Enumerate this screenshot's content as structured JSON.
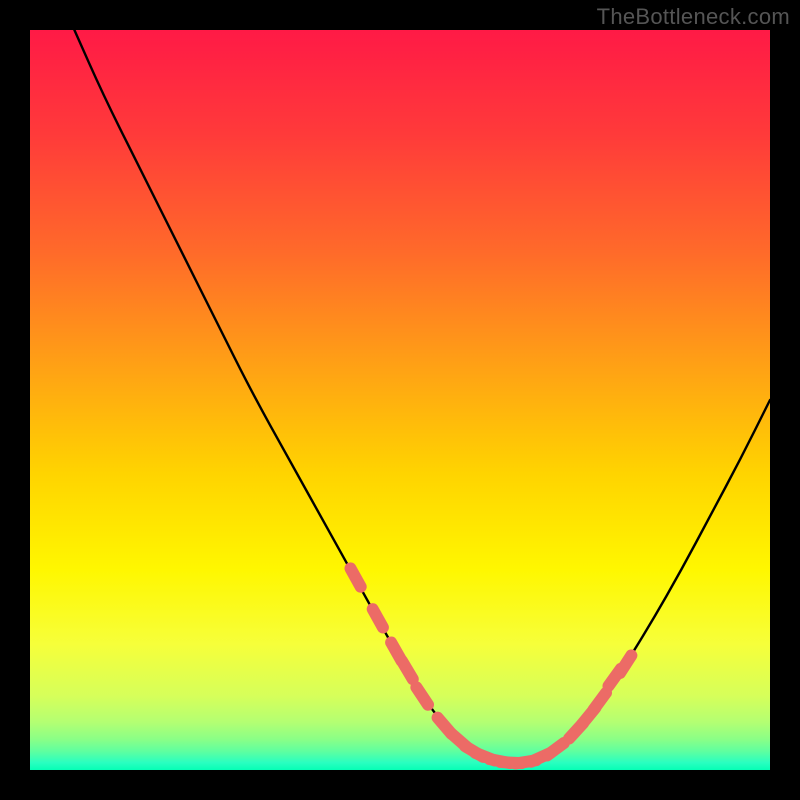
{
  "watermark": "TheBottleneck.com",
  "colors": {
    "frame": "#000000",
    "curve_stroke": "#000000",
    "marker_fill": "#ec6b66",
    "marker_stroke": "#ec6b66",
    "gradient_stops": [
      {
        "offset": 0.0,
        "color": "#ff1a46"
      },
      {
        "offset": 0.14,
        "color": "#ff3a3a"
      },
      {
        "offset": 0.3,
        "color": "#ff6a2a"
      },
      {
        "offset": 0.46,
        "color": "#ffa314"
      },
      {
        "offset": 0.6,
        "color": "#ffd400"
      },
      {
        "offset": 0.73,
        "color": "#fff700"
      },
      {
        "offset": 0.83,
        "color": "#f6ff3a"
      },
      {
        "offset": 0.9,
        "color": "#d6ff5a"
      },
      {
        "offset": 0.935,
        "color": "#b4ff72"
      },
      {
        "offset": 0.958,
        "color": "#8bff86"
      },
      {
        "offset": 0.975,
        "color": "#5effa0"
      },
      {
        "offset": 0.99,
        "color": "#2affc0"
      },
      {
        "offset": 1.0,
        "color": "#06ffb6"
      }
    ]
  },
  "chart_data": {
    "type": "line",
    "title": "",
    "xlabel": "",
    "ylabel": "",
    "xlim": [
      0,
      100
    ],
    "ylim": [
      0,
      100
    ],
    "grid": false,
    "legend": false,
    "series": [
      {
        "name": "bottleneck-curve",
        "x": [
          6,
          10,
          15,
          20,
          25,
          30,
          35,
          40,
          45,
          50,
          53,
          56,
          58,
          60,
          62,
          64,
          66,
          68,
          70,
          73,
          76,
          80,
          84,
          88,
          92,
          96,
          100
        ],
        "y": [
          100,
          91,
          81,
          71,
          61,
          51,
          42,
          33,
          24,
          15,
          10,
          6,
          4,
          2.5,
          1.6,
          1.1,
          1.0,
          1.3,
          2.2,
          4.5,
          8,
          13.5,
          20,
          27,
          34.5,
          42,
          50
        ]
      }
    ],
    "markers": {
      "name": "highlight-points",
      "shape": "rounded-bar",
      "x": [
        44,
        47,
        49.5,
        51,
        53,
        56,
        58,
        60,
        61.5,
        63.5,
        65,
        67,
        69,
        71,
        73.8,
        75.5,
        77,
        79,
        80.5
      ],
      "y": [
        26,
        20.5,
        16,
        13.5,
        10,
        6,
        4,
        2.5,
        1.8,
        1.2,
        1.0,
        1.1,
        1.7,
        2.8,
        5.3,
        7.3,
        9.3,
        12.5,
        14.3
      ]
    }
  }
}
